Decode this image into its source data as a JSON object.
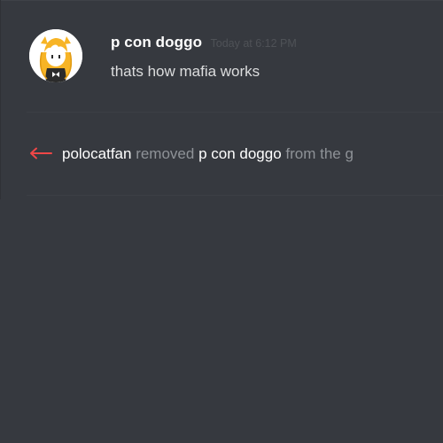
{
  "message": {
    "username": "p con doggo",
    "timestamp": "Today at 6:12 PM",
    "content": "thats how mafia works",
    "avatar_icon": "anime-girl-avatar-icon"
  },
  "system_message": {
    "icon": "left-arrow-removed-icon",
    "icon_color": "#f04747",
    "actor": "polocatfan",
    "verb": "removed",
    "target": "p con doggo",
    "tail": "from the g"
  },
  "colors": {
    "background": "#36393f",
    "username": "#ffffff",
    "message_text": "#dcddde",
    "muted_text": "#8e9297",
    "timestamp": "#4f5257"
  }
}
